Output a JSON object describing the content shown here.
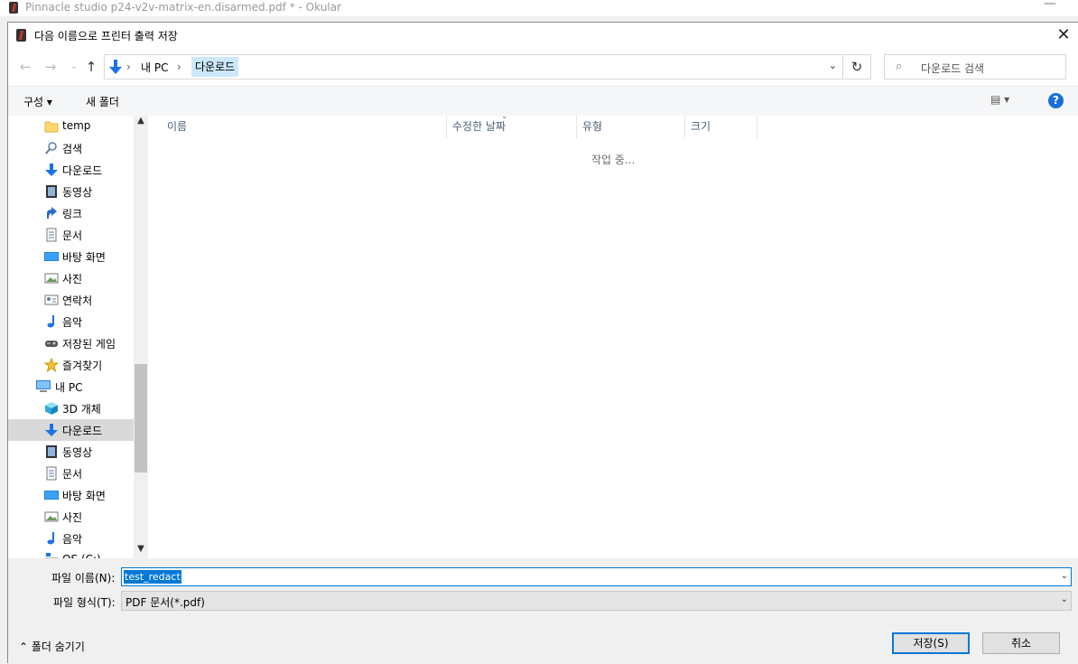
{
  "background_window": {
    "title": "Pinnacle studio p24-v2v-matrix-en.disarmed.pdf * - Okular",
    "minimize": "—"
  },
  "dialog": {
    "title": "다음 이름으로 프린터 출력 저장",
    "close": "✕"
  },
  "nav": {
    "back": "←",
    "forward": "→",
    "recent": "⌄",
    "up": "↑",
    "refresh": "↻"
  },
  "address": {
    "sep1": "›",
    "crumb1": "내 PC",
    "sep2": "›",
    "crumb2": "다운로드",
    "dropdown": "⌄"
  },
  "search": {
    "icon": "⌕",
    "placeholder": "다운로드 검색"
  },
  "toolbar": {
    "organize": "구성 ▾",
    "new_folder": "새 폴더",
    "view": "▤ ▾",
    "help": "?"
  },
  "sidebar": {
    "items": [
      {
        "label": "temp",
        "icon": "folder-icon"
      },
      {
        "label": "검색",
        "icon": "search-icon"
      },
      {
        "label": "다운로드",
        "icon": "download-icon"
      },
      {
        "label": "동영상",
        "icon": "video-icon"
      },
      {
        "label": "링크",
        "icon": "link-icon"
      },
      {
        "label": "문서",
        "icon": "document-icon"
      },
      {
        "label": "바탕 화면",
        "icon": "desktop-icon"
      },
      {
        "label": "사진",
        "icon": "pictures-icon"
      },
      {
        "label": "연락처",
        "icon": "contacts-icon"
      },
      {
        "label": "음악",
        "icon": "music-icon"
      },
      {
        "label": "저장된 게임",
        "icon": "games-icon"
      },
      {
        "label": "즐겨찾기",
        "icon": "favorites-icon"
      },
      {
        "label": "내 PC",
        "icon": "computer-icon"
      },
      {
        "label": "3D 개체",
        "icon": "3d-objects-icon"
      },
      {
        "label": "다운로드",
        "icon": "download-icon",
        "selected": true
      },
      {
        "label": "동영상",
        "icon": "video-icon"
      },
      {
        "label": "문서",
        "icon": "document-icon"
      },
      {
        "label": "바탕 화면",
        "icon": "desktop-icon"
      },
      {
        "label": "사진",
        "icon": "pictures-icon"
      },
      {
        "label": "음악",
        "icon": "music-icon"
      },
      {
        "label": "OS (C:)",
        "icon": "drive-icon"
      }
    ],
    "scroll_up": "▲",
    "scroll_down": "▼"
  },
  "columns": {
    "name": "이름",
    "modified": "수정한 날짜",
    "type": "유형",
    "size": "크기",
    "sort_caret": "⌄"
  },
  "status": {
    "working": "작업 중..."
  },
  "form": {
    "filename_label": "파일 이름(N):",
    "filename_value": "test_redact",
    "filetype_label": "파일 형식(T):",
    "filetype_value": "PDF 문서(*.pdf)",
    "dropdown": "⌄"
  },
  "footer": {
    "hide_folders": "⌃  폴더 숨기기",
    "save": "저장(S)",
    "cancel": "취소"
  },
  "colors": {
    "accent": "#0078d7",
    "selection": "#cce8ff",
    "sidebar_selected": "#d9d9d9",
    "folder": "#ffd86b",
    "download": "#1a73e8"
  }
}
